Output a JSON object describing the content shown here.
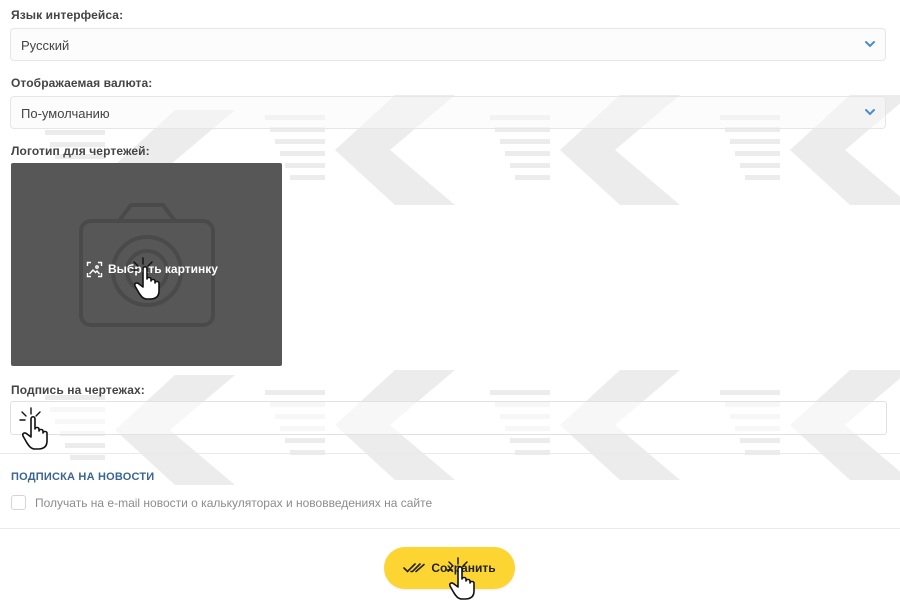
{
  "language": {
    "label": "Язык интерфейса:",
    "value": "Русский"
  },
  "currency": {
    "label": "Отображаемая валюта:",
    "value": "По-умолчанию"
  },
  "logo": {
    "label": "Логотип для чертежей:",
    "choose_label": "Выбрать картинку"
  },
  "signature": {
    "label": "Подпись на чертежах:",
    "value": ""
  },
  "newsletter": {
    "title": "ПОДПИСКА НА НОВОСТИ",
    "checkbox_label": "Получать на e-mail новости о калькуляторах и нововведениях на сайте",
    "checked": false
  },
  "actions": {
    "save_label": "Сохранить"
  },
  "colors": {
    "accent_yellow": "#fcd532",
    "section_title_blue": "#3a6593",
    "logo_panel": "#575757"
  }
}
